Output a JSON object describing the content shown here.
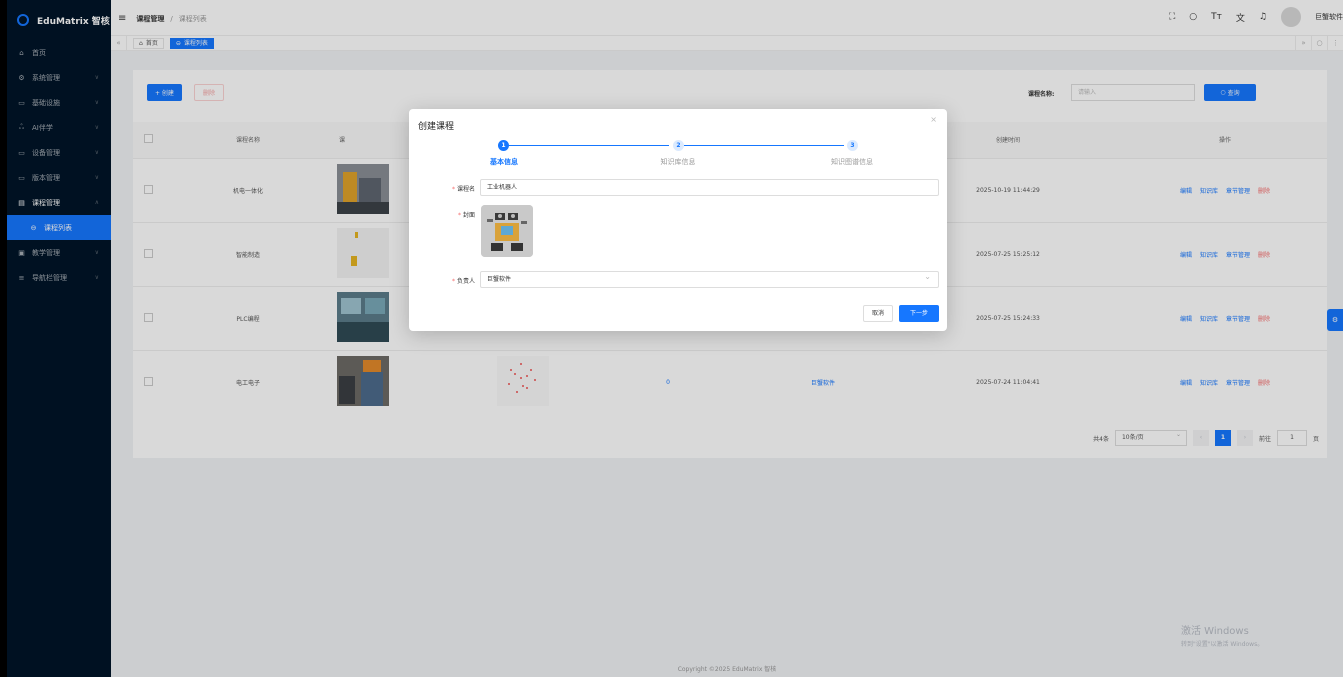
{
  "app": {
    "title": "EduMatrix 智核"
  },
  "sidebar": {
    "items": [
      {
        "label": "首页",
        "icon": "home-icon"
      },
      {
        "label": "系统管理",
        "icon": "gear-icon"
      },
      {
        "label": "基础设施",
        "icon": "monitor-icon"
      },
      {
        "label": "AI伴学",
        "icon": "ai-icon"
      },
      {
        "label": "设备管理",
        "icon": "monitor-icon"
      },
      {
        "label": "版本管理",
        "icon": "folder-icon"
      },
      {
        "label": "课程管理",
        "icon": "book-icon"
      },
      {
        "label": "课程列表",
        "icon": "list-icon"
      },
      {
        "label": "教学管理",
        "icon": "doc-icon"
      },
      {
        "label": "导航栏管理",
        "icon": "menu-icon"
      }
    ]
  },
  "header": {
    "breadcrumb": [
      "课程管理",
      "课程列表"
    ],
    "user_name": "巨蟹软件"
  },
  "tags": {
    "items": [
      "首页",
      "课程列表"
    ]
  },
  "toolbar": {
    "create_label": "+ 创建",
    "delete_label": "删除",
    "search_label": "课程名称:",
    "search_placeholder": "请输入",
    "search_button": "查询"
  },
  "table": {
    "columns": [
      "课程名称",
      "课",
      "创建时间",
      "操作"
    ],
    "rows": [
      {
        "name": "机电一体化",
        "created": "2025-10-19 11:44:29"
      },
      {
        "name": "智能制造",
        "created": "2025-07-25 15:25:12"
      },
      {
        "name": "PLC编程",
        "created": "2025-07-25 15:24:33"
      },
      {
        "name": "电工电子",
        "count": "0",
        "owner": "巨蟹软件",
        "created": "2025-07-24 11:04:41"
      }
    ],
    "ops": [
      "编辑",
      "知识库",
      "章节管理",
      "删除"
    ]
  },
  "pagination": {
    "total": "共4条",
    "page_size": "10条/页",
    "current": "1",
    "goto_label": "前往",
    "goto_value": "1",
    "page_unit": "页"
  },
  "footer": {
    "copyright": "Copyright ©2025 EduMatrix 智核"
  },
  "watermark": {
    "line1": "激活 Windows",
    "line2": "转到\"设置\"以激活 Windows。"
  },
  "modal": {
    "title": "创建课程",
    "steps": [
      {
        "num": "1",
        "label": "基本信息"
      },
      {
        "num": "2",
        "label": "知识库信息"
      },
      {
        "num": "3",
        "label": "知识图谱信息"
      }
    ],
    "fields": {
      "course_name_label": "课程名",
      "course_name_value": "工业机器人",
      "cover_label": "封面",
      "owner_label": "负责人",
      "owner_value": "巨蟹软件"
    },
    "cancel_label": "取消",
    "next_label": "下一步"
  },
  "colors": {
    "primary": "#1677ff",
    "danger": "#f56c6c",
    "sidebar_bg": "#001529"
  }
}
